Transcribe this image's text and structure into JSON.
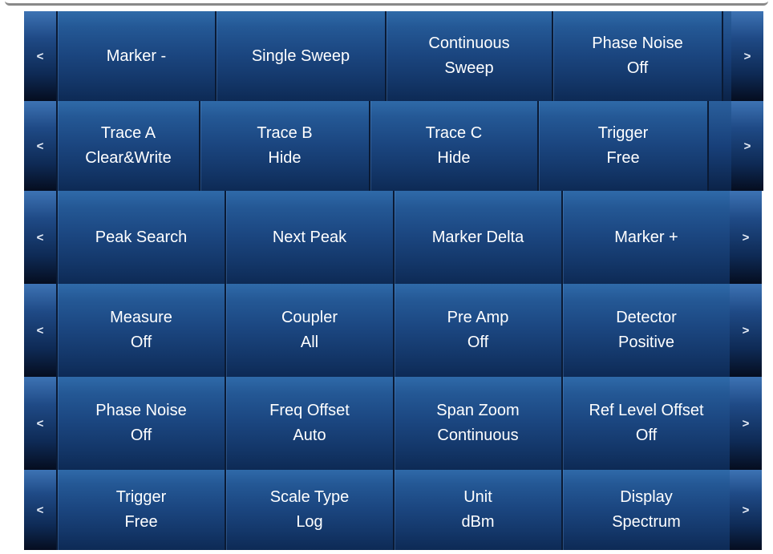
{
  "nav": {
    "prev": "<",
    "next": ">"
  },
  "panels": [
    {
      "buttons": [
        {
          "line1": "Marker -",
          "line2": ""
        },
        {
          "line1": "Single Sweep",
          "line2": ""
        },
        {
          "line1": "Continuous",
          "line2": "Sweep"
        },
        {
          "line1": "Phase Noise",
          "line2": "Off"
        }
      ]
    },
    {
      "buttons": [
        {
          "line1": "Trace A",
          "line2": "Clear&Write"
        },
        {
          "line1": "Trace B",
          "line2": "Hide"
        },
        {
          "line1": "Trace C",
          "line2": "Hide"
        },
        {
          "line1": "Trigger",
          "line2": "Free"
        }
      ]
    },
    {
      "buttons": [
        {
          "line1": "Peak Search",
          "line2": ""
        },
        {
          "line1": "Next Peak",
          "line2": ""
        },
        {
          "line1": "Marker Delta",
          "line2": ""
        },
        {
          "line1": "Marker +",
          "line2": ""
        }
      ]
    },
    {
      "buttons": [
        {
          "line1": "Measure",
          "line2": "Off"
        },
        {
          "line1": "Coupler",
          "line2": "All"
        },
        {
          "line1": "Pre Amp",
          "line2": "Off"
        },
        {
          "line1": "Detector",
          "line2": "Positive"
        }
      ]
    },
    {
      "buttons": [
        {
          "line1": "Phase Noise",
          "line2": "Off"
        },
        {
          "line1": "Freq Offset",
          "line2": "Auto"
        },
        {
          "line1": "Span Zoom",
          "line2": "Continuous"
        },
        {
          "line1": "Ref Level Offset",
          "line2": "Off"
        }
      ]
    },
    {
      "buttons": [
        {
          "line1": "Trigger",
          "line2": "Free"
        },
        {
          "line1": "Scale Type",
          "line2": "Log"
        },
        {
          "line1": "Unit",
          "line2": "dBm"
        },
        {
          "line1": "Display",
          "line2": "Spectrum"
        }
      ]
    }
  ]
}
